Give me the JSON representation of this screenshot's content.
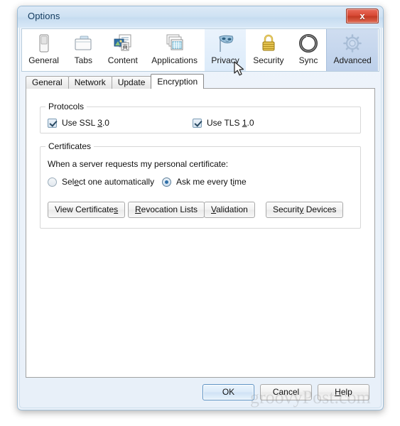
{
  "window": {
    "title": "Options",
    "close_label": "x"
  },
  "toolbar": {
    "items": [
      {
        "label": "General",
        "icon": "general-switch-icon",
        "state": "normal"
      },
      {
        "label": "Tabs",
        "icon": "tabs-folder-icon",
        "state": "normal"
      },
      {
        "label": "Content",
        "icon": "content-page-icon",
        "state": "normal"
      },
      {
        "label": "Applications",
        "icon": "applications-grid-icon",
        "state": "normal"
      },
      {
        "label": "Privacy",
        "icon": "privacy-mask-icon",
        "state": "hover"
      },
      {
        "label": "Security",
        "icon": "security-padlock-icon",
        "state": "normal"
      },
      {
        "label": "Sync",
        "icon": "sync-refresh-icon",
        "state": "normal"
      },
      {
        "label": "Advanced",
        "icon": "advanced-gear-icon",
        "state": "selected"
      }
    ]
  },
  "subtabs": {
    "items": [
      {
        "label": "General",
        "active": false
      },
      {
        "label": "Network",
        "active": false
      },
      {
        "label": "Update",
        "active": false
      },
      {
        "label": "Encryption",
        "active": true
      }
    ]
  },
  "protocols": {
    "legend": "Protocols",
    "ssl": {
      "label_before": "Use SSL ",
      "accel": "3",
      "label_after": ".0",
      "checked": true
    },
    "tls": {
      "label_before": "Use TLS ",
      "accel": "1",
      "label_after": ".0",
      "checked": true
    }
  },
  "certificates": {
    "legend": "Certificates",
    "prompt": "When a server requests my personal certificate:",
    "radio_auto": {
      "before": "Sel",
      "accel": "e",
      "after": "ct one automatically",
      "selected": false
    },
    "radio_ask": {
      "before": "Ask me every t",
      "accel": "i",
      "after": "me",
      "selected": true
    },
    "buttons": [
      {
        "before": "View Certificate",
        "accel": "s",
        "after": ""
      },
      {
        "before": "",
        "accel": "R",
        "after": "evocation Lists"
      },
      {
        "before": "",
        "accel": "V",
        "after": "alidation"
      },
      {
        "before": "Securit",
        "accel": "y",
        "after": " Devices"
      }
    ]
  },
  "dialog_buttons": {
    "ok": {
      "label": "OK",
      "default": true
    },
    "cancel": {
      "label": "Cancel",
      "default": false
    },
    "help": {
      "before": "",
      "accel": "H",
      "after": "elp",
      "default": false
    }
  },
  "watermark": {
    "text": "groovyPost.com"
  },
  "colors": {
    "accent_blue": "#2f6fa8",
    "title_text": "#123a5e",
    "close_red": "#d94a36",
    "selected_tab": "#bdd0ea"
  }
}
